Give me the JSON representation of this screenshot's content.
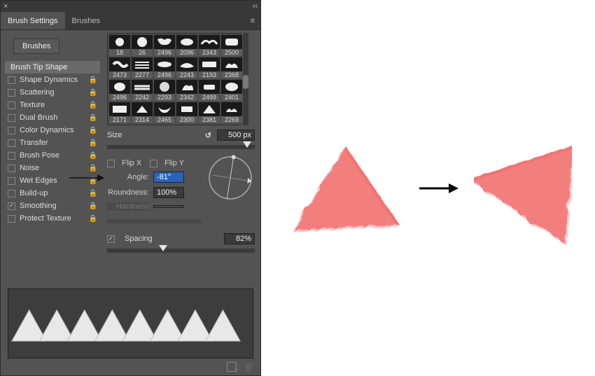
{
  "header": {
    "tab_settings": "Brush Settings",
    "tab_brushes": "Brushes"
  },
  "sidebar": {
    "brushes_button": "Brushes",
    "categories": [
      {
        "label": "Brush Tip Shape",
        "checkbox": false,
        "lock": false,
        "selected": true
      },
      {
        "label": "Shape Dynamics",
        "checkbox": true,
        "checked": false,
        "lock": true
      },
      {
        "label": "Scattering",
        "checkbox": true,
        "checked": false,
        "lock": true
      },
      {
        "label": "Texture",
        "checkbox": true,
        "checked": false,
        "lock": true
      },
      {
        "label": "Dual Brush",
        "checkbox": true,
        "checked": false,
        "lock": true
      },
      {
        "label": "Color Dynamics",
        "checkbox": true,
        "checked": false,
        "lock": true
      },
      {
        "label": "Transfer",
        "checkbox": true,
        "checked": false,
        "lock": true
      },
      {
        "label": "Brush Pose",
        "checkbox": true,
        "checked": false,
        "lock": true
      },
      {
        "label": "Noise",
        "checkbox": true,
        "checked": false,
        "lock": true
      },
      {
        "label": "Wet Edges",
        "checkbox": true,
        "checked": false,
        "lock": true
      },
      {
        "label": "Build-up",
        "checkbox": true,
        "checked": false,
        "lock": true
      },
      {
        "label": "Smoothing",
        "checkbox": true,
        "checked": true,
        "lock": true
      },
      {
        "label": "Protect Texture",
        "checkbox": true,
        "checked": false,
        "lock": true
      }
    ]
  },
  "brush_grid": {
    "numbers": [
      "18",
      "26",
      "2496",
      "2096",
      "2343",
      "2500",
      "2473",
      "2277",
      "2496",
      "2243",
      "2193",
      "2368",
      "2496",
      "2242",
      "2293",
      "2342",
      "2499",
      "2401",
      "2171",
      "2314",
      "2465",
      "2300",
      "2381",
      "2269"
    ]
  },
  "tip": {
    "size_label": "Size",
    "size_value": "500 px",
    "flip_x": "Flip X",
    "flip_y": "Flip Y",
    "angle_label": "Angle:",
    "angle_value": "-81°",
    "roundness_label": "Roundness:",
    "roundness_value": "100%",
    "hardness_label": "Hardness",
    "spacing_label": "Spacing",
    "spacing_checked": true,
    "spacing_value": "82%"
  },
  "colors": {
    "brush_stroke": "#f27272"
  }
}
